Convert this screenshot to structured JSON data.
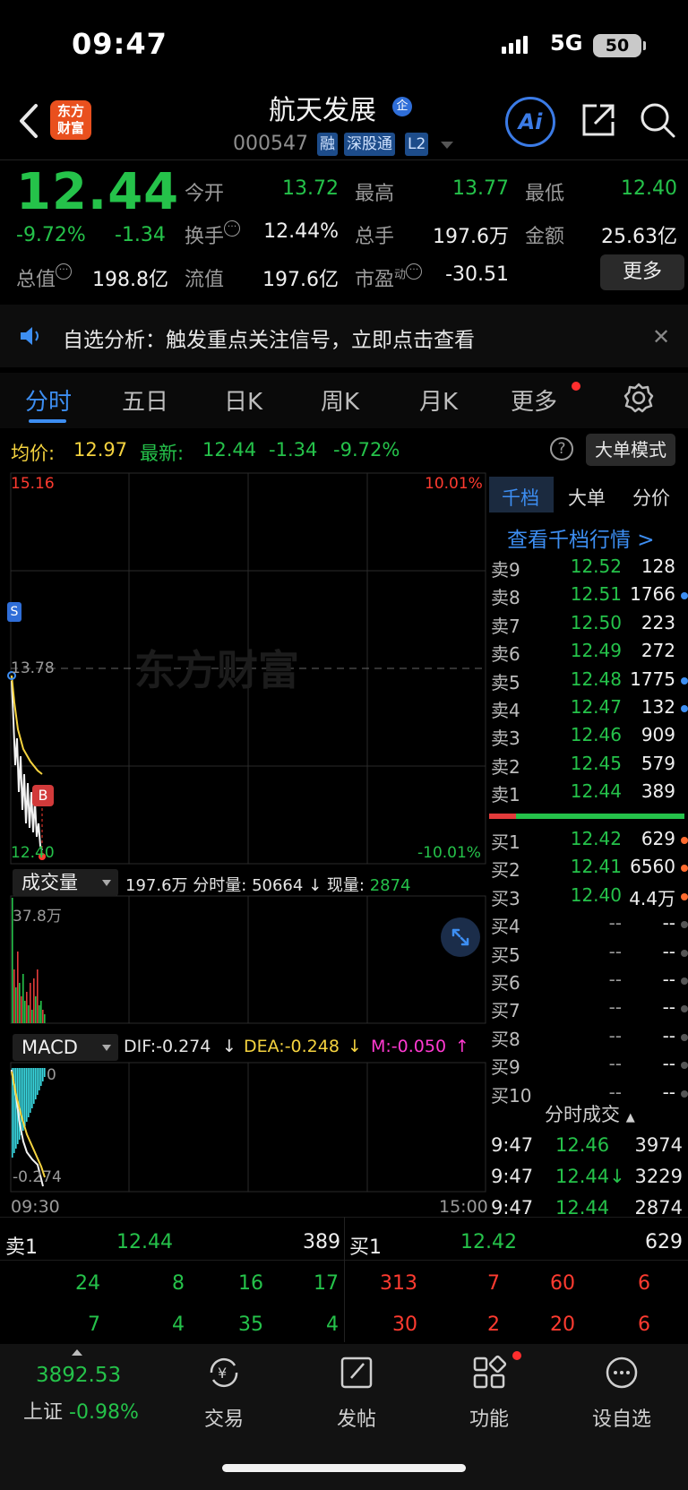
{
  "status": {
    "time": "09:47",
    "network": "5G",
    "battery": "50"
  },
  "header": {
    "logo_line1": "东方",
    "logo_line2": "财富",
    "stock_name": "航天发展",
    "qi_badge": "企",
    "stock_code": "000547",
    "tags": [
      "融",
      "深股通",
      "L2"
    ],
    "ai_label": "Ai"
  },
  "quote": {
    "price": "12.44",
    "change_pct": "-9.72%",
    "change_abs": "-1.34",
    "fields": [
      {
        "label": "今开",
        "value": "13.72",
        "color": "green"
      },
      {
        "label": "最高",
        "value": "13.77",
        "color": "green"
      },
      {
        "label": "最低",
        "value": "12.40",
        "color": "green"
      },
      {
        "label": "换手",
        "value": "12.44%",
        "color": "white"
      },
      {
        "label": "总手",
        "value": "197.6万",
        "color": "white"
      },
      {
        "label": "金额",
        "value": "25.63亿",
        "color": "white"
      },
      {
        "label": "总值",
        "value": "198.8亿",
        "color": "white"
      },
      {
        "label": "流值",
        "value": "197.6亿",
        "color": "white"
      },
      {
        "label": "市盈",
        "sup": "动",
        "value": "-30.51",
        "color": "white"
      }
    ],
    "more_label": "更多"
  },
  "notice": {
    "text": "自选分析：触发重点关注信号，立即点击查看"
  },
  "tabs": [
    "分时",
    "五日",
    "日K",
    "周K",
    "月K",
    "更多"
  ],
  "avg_line": {
    "avg_label": "均价:",
    "avg_value": "12.97",
    "latest_label": "最新:",
    "latest_value": "12.44",
    "latest_change": "-1.34",
    "latest_pct": "-9.72%",
    "big_order_label": "大单模式"
  },
  "chart": {
    "price_high": "15.16",
    "pct_high": "10.01%",
    "pre_close": "13.78",
    "price_low": "12.40",
    "pct_low": "-10.01%",
    "watermark": "东方财富",
    "marker_b": "B",
    "marker_s": "S",
    "time_start": "09:30",
    "time_end": "15:00"
  },
  "volume": {
    "selector": "成交量",
    "total": "197.6万",
    "period_label": "分时量:",
    "period_value": "50664",
    "now_label": "现量:",
    "now_value": "2874",
    "max_label": "37.8万"
  },
  "macd": {
    "selector": "MACD",
    "dif": "DIF:-0.274",
    "dea": "DEA:-0.248",
    "m": "M:-0.050",
    "top_label": "0",
    "bottom_label": "-0.274"
  },
  "orderbook": {
    "tabs": [
      "千档",
      "大单",
      "分价"
    ],
    "link": "查看千档行情 >",
    "asks": [
      {
        "label": "卖9",
        "price": "12.52",
        "vol": "128",
        "dot": ""
      },
      {
        "label": "卖8",
        "price": "12.51",
        "vol": "1766",
        "dot": "#3d8ef2"
      },
      {
        "label": "卖7",
        "price": "12.50",
        "vol": "223",
        "dot": ""
      },
      {
        "label": "卖6",
        "price": "12.49",
        "vol": "272",
        "dot": ""
      },
      {
        "label": "卖5",
        "price": "12.48",
        "vol": "1775",
        "dot": "#3d8ef2"
      },
      {
        "label": "卖4",
        "price": "12.47",
        "vol": "132",
        "dot": "#3d8ef2"
      },
      {
        "label": "卖3",
        "price": "12.46",
        "vol": "909",
        "dot": ""
      },
      {
        "label": "卖2",
        "price": "12.45",
        "vol": "579",
        "dot": ""
      },
      {
        "label": "卖1",
        "price": "12.44",
        "vol": "389",
        "dot": ""
      }
    ],
    "bids": [
      {
        "label": "买1",
        "price": "12.42",
        "vol": "629",
        "dot": "#ff6a2e"
      },
      {
        "label": "买2",
        "price": "12.41",
        "vol": "6560",
        "dot": "#ff6a2e"
      },
      {
        "label": "买3",
        "price": "12.40",
        "vol": "4.4万",
        "dot": "#ff6a2e"
      },
      {
        "label": "买4",
        "price": "--",
        "vol": "--",
        "dot": "#555"
      },
      {
        "label": "买5",
        "price": "--",
        "vol": "--",
        "dot": "#555"
      },
      {
        "label": "买6",
        "price": "--",
        "vol": "--",
        "dot": "#555"
      },
      {
        "label": "买7",
        "price": "--",
        "vol": "--",
        "dot": "#555"
      },
      {
        "label": "买8",
        "price": "--",
        "vol": "--",
        "dot": "#555"
      },
      {
        "label": "买9",
        "price": "--",
        "vol": "--",
        "dot": "#555"
      },
      {
        "label": "买10",
        "price": "--",
        "vol": "--",
        "dot": "#555"
      }
    ],
    "ticks_title": "分时成交",
    "ticks": [
      {
        "time": "9:47",
        "price": "12.46",
        "vol": "3974",
        "color": "green"
      },
      {
        "time": "9:47",
        "price": "12.44↓",
        "vol": "3229",
        "color": "green"
      },
      {
        "time": "9:47",
        "price": "12.44",
        "vol": "2874",
        "color": "green"
      }
    ]
  },
  "bottom_book": {
    "ask_label": "卖1",
    "ask_price": "12.44",
    "ask_vol": "389",
    "bid_label": "买1",
    "bid_price": "12.42",
    "bid_vol": "629",
    "ask_rows": [
      [
        "24",
        "8",
        "16",
        "17"
      ],
      [
        "7",
        "4",
        "35",
        "4"
      ]
    ],
    "bid_rows": [
      [
        "313",
        "7",
        "60",
        "6"
      ],
      [
        "30",
        "2",
        "20",
        "6"
      ]
    ]
  },
  "nav": {
    "index_value": "3892.53",
    "index_name": "上证",
    "index_pct": "-0.98%",
    "items": [
      "交易",
      "发帖",
      "功能",
      "设自选"
    ]
  }
}
